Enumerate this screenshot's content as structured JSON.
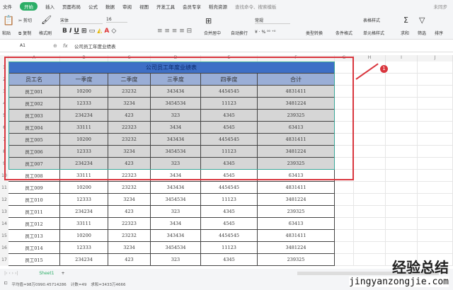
{
  "menu": {
    "items": [
      "文件",
      "开始",
      "插入",
      "页面布局",
      "公式",
      "数据",
      "审阅",
      "视图",
      "开发工具",
      "会员专享",
      "稻壳资源"
    ],
    "active": "开始",
    "search": "查找命令、搜索模板",
    "sync": "未同步"
  },
  "ribbon": {
    "paste": "粘贴",
    "cut": "剪切",
    "copy": "复制",
    "format_painter": "格式刷",
    "font": "宋体",
    "size": "16",
    "merge": "合并居中",
    "wrap": "自动换行",
    "number_format": "常规",
    "type_convert": "类型转换",
    "cond_format": "条件格式",
    "table_style": "表格样式",
    "cell_style": "单元格样式",
    "sum": "求和",
    "filter": "筛选",
    "sort": "排序"
  },
  "formula_bar": {
    "name_box": "A1",
    "fx": "fx",
    "content": "公司员工年度业绩表"
  },
  "columns": [
    "A",
    "B",
    "C",
    "D",
    "E",
    "F",
    "G",
    "H",
    "I",
    "J"
  ],
  "table": {
    "title": "公司员工年度业绩表",
    "headers": [
      "员工名",
      "一季度",
      "二季度",
      "三季度",
      "四季度",
      "合计"
    ],
    "rows": [
      [
        "员工001",
        "10200",
        "23232",
        "343434",
        "4454545",
        "4831411"
      ],
      [
        "员工002",
        "12333",
        "3234",
        "3454534",
        "11123",
        "3481224"
      ],
      [
        "员工003",
        "234234",
        "423",
        "323",
        "4345",
        "239325"
      ],
      [
        "员工004",
        "33111",
        "22323",
        "3434",
        "4545",
        "63413"
      ],
      [
        "员工005",
        "10200",
        "23232",
        "343434",
        "4454545",
        "4831411"
      ],
      [
        "员工006",
        "12333",
        "3234",
        "3454534",
        "11123",
        "3481224"
      ],
      [
        "员工007",
        "234234",
        "423",
        "323",
        "4345",
        "239325"
      ],
      [
        "员工008",
        "33111",
        "22323",
        "3434",
        "4545",
        "63413"
      ],
      [
        "员工009",
        "10200",
        "23232",
        "343434",
        "4454545",
        "4831411"
      ],
      [
        "员工010",
        "12333",
        "3234",
        "3454534",
        "11123",
        "3481224"
      ],
      [
        "员工011",
        "234234",
        "423",
        "323",
        "4345",
        "239325"
      ],
      [
        "员工012",
        "33111",
        "22323",
        "3434",
        "4545",
        "63413"
      ],
      [
        "员工013",
        "10200",
        "23232",
        "343434",
        "4454545",
        "4831411"
      ],
      [
        "员工014",
        "12333",
        "3234",
        "3454534",
        "11123",
        "3481224"
      ],
      [
        "员工015",
        "234234",
        "423",
        "323",
        "4345",
        "239325"
      ]
    ]
  },
  "annotation": {
    "badge": "1"
  },
  "sheet": {
    "tab": "Sheet1",
    "add": "+"
  },
  "status": {
    "avg": "平均值=98万0990.45714286",
    "count": "计数=49",
    "sum": "求和=3433万4666"
  },
  "watermark": {
    "cn": "经验总结",
    "url": "jingyanzongjie.com"
  },
  "colors": {
    "title_bg": "#3e6fc6",
    "header_bg": "#9aaed6",
    "selected_bg": "#d6d6d6",
    "accent": "#2bae66",
    "annotation": "#d9363e"
  }
}
